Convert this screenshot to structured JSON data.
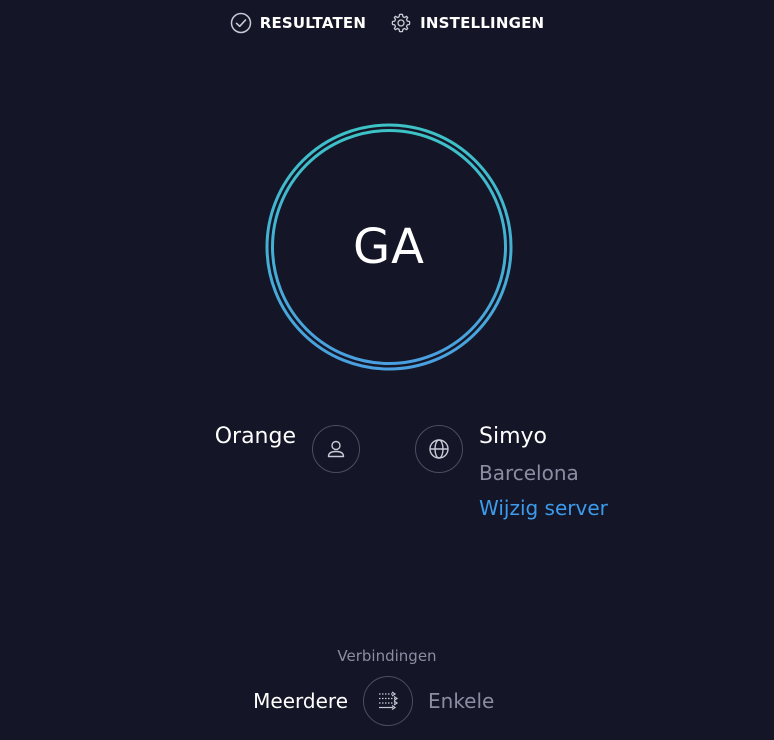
{
  "nav": {
    "results_label": "RESULTATEN",
    "settings_label": "INSTELLINGEN",
    "results_icon": "check-circle-icon",
    "settings_icon": "gear-icon"
  },
  "start": {
    "label": "GA"
  },
  "provider": {
    "name": "Orange",
    "icon": "user-icon"
  },
  "server": {
    "name": "Simyo",
    "location": "Barcelona",
    "change_label": "Wijzig server",
    "icon": "globe-icon"
  },
  "connections": {
    "title": "Verbindingen",
    "multi_label": "Meerdere",
    "single_label": "Enkele",
    "icon": "connections-toggle-icon"
  },
  "colors": {
    "background": "#141526",
    "ring_primary": "#3dc2c6",
    "ring_secondary": "#4a9fe0",
    "link": "#3c9bec",
    "muted": "#8b8da3"
  }
}
